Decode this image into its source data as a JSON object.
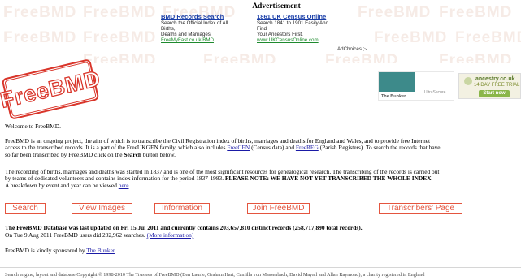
{
  "watermark": {
    "text": "FreeBMD"
  },
  "advertisement": {
    "heading": "Advertisement",
    "ads": [
      {
        "title": "BMD Records Search",
        "line1": "Search the Official Index of All Births,",
        "line2": "Deaths and Marriages!",
        "url": "FreeMyFast.co.uk/BMD"
      },
      {
        "title": "1861 UK Census Online",
        "line1": "Search 1841 to 1901 Easily And Find",
        "line2": "Your Ancestors First.",
        "url": "www.UKCensusOnline.com"
      }
    ],
    "adchoices": "AdChoices ▷"
  },
  "logo": {
    "text": "FreeBMD"
  },
  "banners": {
    "bunker": {
      "name": "The Bunker",
      "tag": "UltraSecure"
    },
    "ancestry": {
      "logo": "ancestry.co.uk",
      "trial": "14 DAY FREE TRIAL",
      "button": "Start now"
    }
  },
  "welcome": "Welcome to FreeBMD.",
  "intro": {
    "line1": "FreeBMD is an ongoing project, the aim of which is to transcribe the Civil Registration index of births, marriages and deaths for England and Wales, and to provide free Internet",
    "line2a": "access to the transcribed records. It is a part of the FreeUKGEN family, which also includes ",
    "freecen": "FreeCEN",
    "line2b": " (Census data) and ",
    "freereg": "FreeREG",
    "line2c": " (Parish Registers). To search the records that have",
    "line3a": "so far been transcribed by FreeBMD click on the ",
    "line3b": "Search",
    "line3c": " button below."
  },
  "recording": {
    "line1": "The recording of births, marriages and deaths was started in 1837 and is one of the most significant resources for genealogical research. The transcribing of the records is carried out",
    "line2a": "by teams of dedicated volunteers and contains index information for the period 1837-1983. ",
    "line2b": "PLEASE NOTE: WE HAVE NOT YET TRANSCRIBED THE WHOLE INDEX",
    "line3a": "A breakdown by event and year can be viewed ",
    "here": "here"
  },
  "nav": {
    "search": "Search",
    "view_images": "View Images",
    "information": "Information",
    "join": "Join FreeBMD",
    "transcribers": "Transcribers' Page"
  },
  "stats": {
    "updated": "The FreeBMD Database was last updated on Fri 15 Jul 2011 and currently contains 203,657,810 distinct records (258,717,890 total records).",
    "searches": "On Tue 9 Aug 2011 FreeBMD users did 202,962 searches. ",
    "more": "(More information)"
  },
  "sponsor": {
    "text": "FreeBMD is kindly sponsored by ",
    "link": "The Bunker",
    "period": "."
  },
  "footer": "Search engine, layout and database Copyright © 1998-2010 The Trustees of FreeBMD (Ben Laurie, Graham Hart, Camilla von Massenbach, David Mayall and Allan Raymond), a charity registered in England"
}
